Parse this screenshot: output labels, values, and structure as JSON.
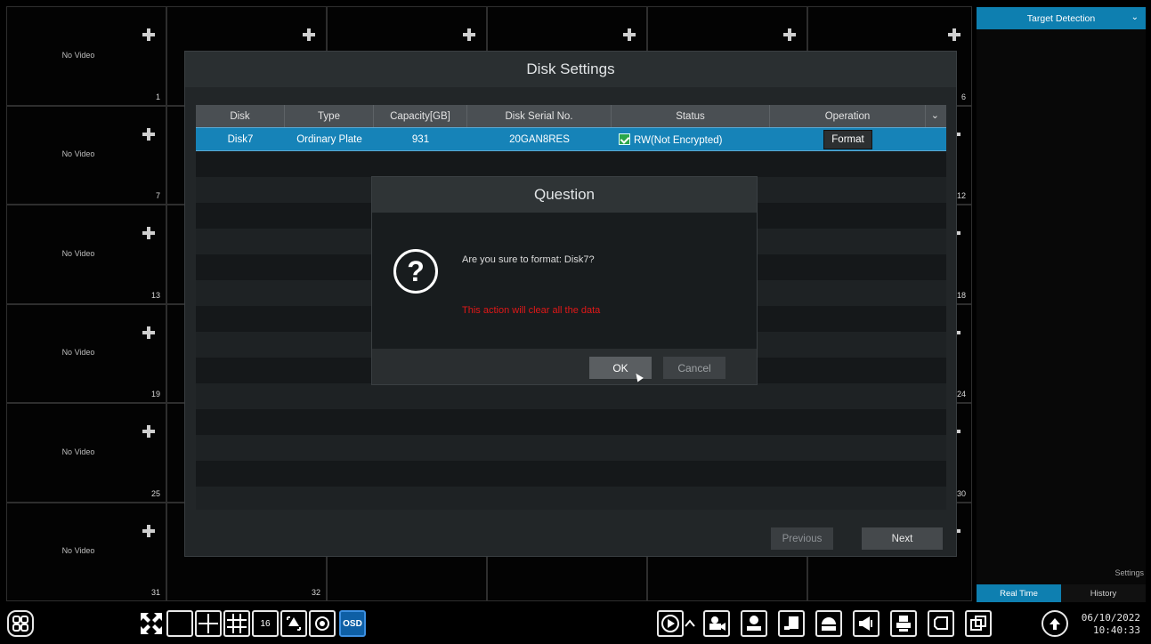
{
  "grid": {
    "no_video_label": "No Video",
    "cells": [
      {
        "num": "1"
      },
      {
        "num": ""
      },
      {
        "num": ""
      },
      {
        "num": ""
      },
      {
        "num": ""
      },
      {
        "num": "6"
      },
      {
        "num": "7"
      },
      {
        "num": ""
      },
      {
        "num": ""
      },
      {
        "num": ""
      },
      {
        "num": ""
      },
      {
        "num": "12"
      },
      {
        "num": "13"
      },
      {
        "num": ""
      },
      {
        "num": ""
      },
      {
        "num": ""
      },
      {
        "num": ""
      },
      {
        "num": "18"
      },
      {
        "num": "19"
      },
      {
        "num": ""
      },
      {
        "num": ""
      },
      {
        "num": ""
      },
      {
        "num": ""
      },
      {
        "num": "24"
      },
      {
        "num": "25"
      },
      {
        "num": ""
      },
      {
        "num": ""
      },
      {
        "num": ""
      },
      {
        "num": ""
      },
      {
        "num": "30"
      },
      {
        "num": "31"
      },
      {
        "num": "32"
      },
      {
        "num": ""
      },
      {
        "num": ""
      },
      {
        "num": ""
      },
      {
        "num": ""
      }
    ]
  },
  "right_panel": {
    "dropdown_label": "Target Detection",
    "settings_label": "Settings",
    "tabs": [
      {
        "label": "Real Time",
        "active": true
      },
      {
        "label": "History",
        "active": false
      }
    ]
  },
  "disk_settings": {
    "title": "Disk Settings",
    "columns": [
      "Disk",
      "Type",
      "Capacity[GB]",
      "Disk Serial No.",
      "Status",
      "Operation"
    ],
    "row": {
      "disk": "Disk7",
      "type": "Ordinary Plate",
      "capacity": "931",
      "serial": "20GAN8RES",
      "status": "RW(Not Encrypted)",
      "operation": "Format"
    },
    "previous_label": "Previous",
    "next_label": "Next"
  },
  "question": {
    "title": "Question",
    "message": "Are you sure to format: Disk7?",
    "warning": "This action will clear all the data",
    "ok_label": "OK",
    "cancel_label": "Cancel"
  },
  "taskbar": {
    "osd_label": "OSD",
    "multiscreen_label": "16",
    "date": "06/10/2022",
    "time": "10:40:33"
  },
  "colors": {
    "accent": "#0e7fb0",
    "selected_row": "#1683b8",
    "warning": "#e01818"
  }
}
